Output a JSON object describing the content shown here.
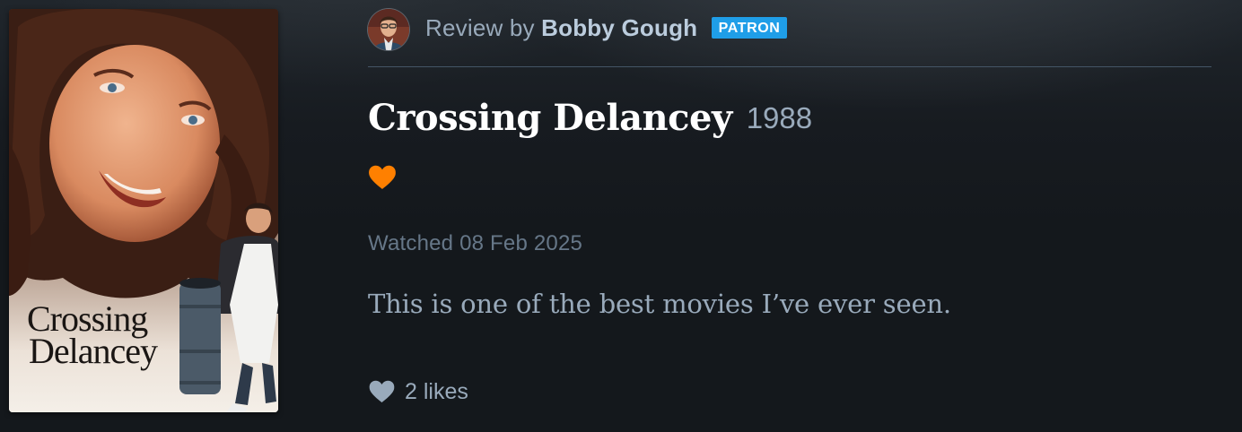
{
  "review": {
    "prefix": "Review by",
    "reviewer": "Bobby Gough",
    "badge": "PATRON",
    "film_title": "Crossing Delancey",
    "film_year": "1988",
    "liked_icon": "heart-icon",
    "watched": "Watched 08 Feb 2025",
    "body": "This is one of the best movies I’ve ever seen.",
    "likes_label": "2 likes",
    "likes_icon": "heart-icon"
  },
  "poster": {
    "title_line1": "Crossing",
    "title_line2": "Delancey"
  },
  "colors": {
    "background": "#14181c",
    "badge": "#1f9ee8",
    "liked_heart": "#ff8000",
    "muted_text": "#99aabb",
    "divider": "#445566"
  }
}
